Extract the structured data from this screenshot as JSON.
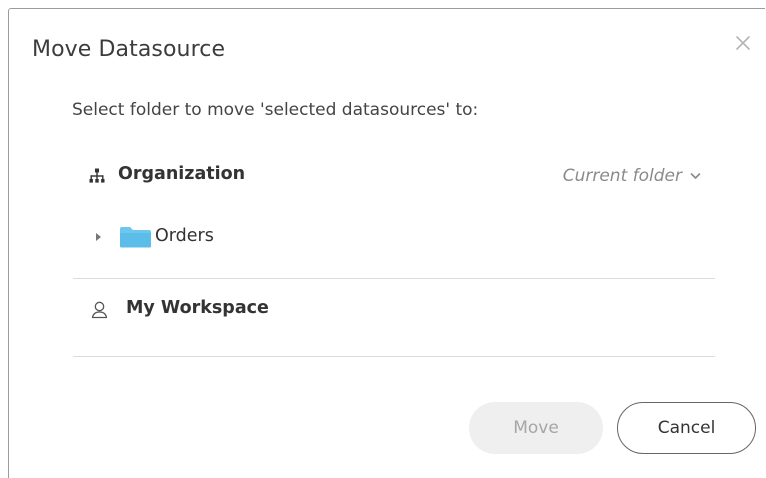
{
  "dialog": {
    "title": "Move Datasource",
    "close_icon": "close-icon",
    "instruction": "Select folder to move 'selected datasources' to:"
  },
  "folders": {
    "organization": {
      "icon": "organization-icon",
      "label": "Organization",
      "current_folder_label": "Current folder",
      "chevron_icon": "chevron-down-icon"
    },
    "orders": {
      "expand_icon": "caret-right-icon",
      "icon": "folder-icon",
      "label": "Orders",
      "folder_color": "#6cc7ef"
    },
    "workspace": {
      "icon": "user-icon",
      "label": "My Workspace"
    }
  },
  "buttons": {
    "move_label": "Move",
    "move_disabled": true,
    "cancel_label": "Cancel"
  }
}
